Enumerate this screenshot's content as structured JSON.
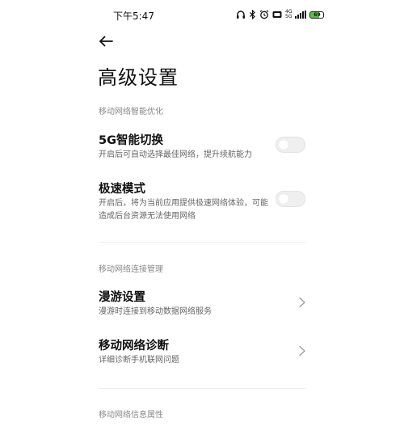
{
  "status_bar": {
    "time": "下午5:47",
    "network_top": "4G",
    "network_bottom": "5G",
    "battery_level": "69",
    "icons": [
      "headset-icon",
      "bluetooth-icon",
      "alarm-icon",
      "hd-icon",
      "signal-icon",
      "battery-icon"
    ],
    "battery_color": "#5bbf4a"
  },
  "header": {
    "back_icon": "arrow-left-icon",
    "title": "高级设置"
  },
  "sections": [
    {
      "header": "移动网络智能优化",
      "items": [
        {
          "title": "5G智能切换",
          "description": "开启后可自动选择最佳网络，提升续航能力",
          "control": "toggle",
          "enabled": false
        },
        {
          "title": "极速模式",
          "description": "开启后，将为当前应用提供极速网络体验，可能造成后台资源无法使用网络",
          "control": "toggle",
          "enabled": false
        }
      ]
    },
    {
      "header": "移动网络连接管理",
      "items": [
        {
          "title": "漫游设置",
          "description": "漫游时连接到移动数据网络服务",
          "control": "chevron"
        },
        {
          "title": "移动网络诊断",
          "description": "详细诊断手机联网问题",
          "control": "chevron"
        }
      ]
    },
    {
      "header": "移动网络信息属性",
      "items": []
    }
  ],
  "colors": {
    "toggle_off_bg": "#efefef",
    "secondary_text": "#666666",
    "section_header_text": "#8a8a8a"
  }
}
